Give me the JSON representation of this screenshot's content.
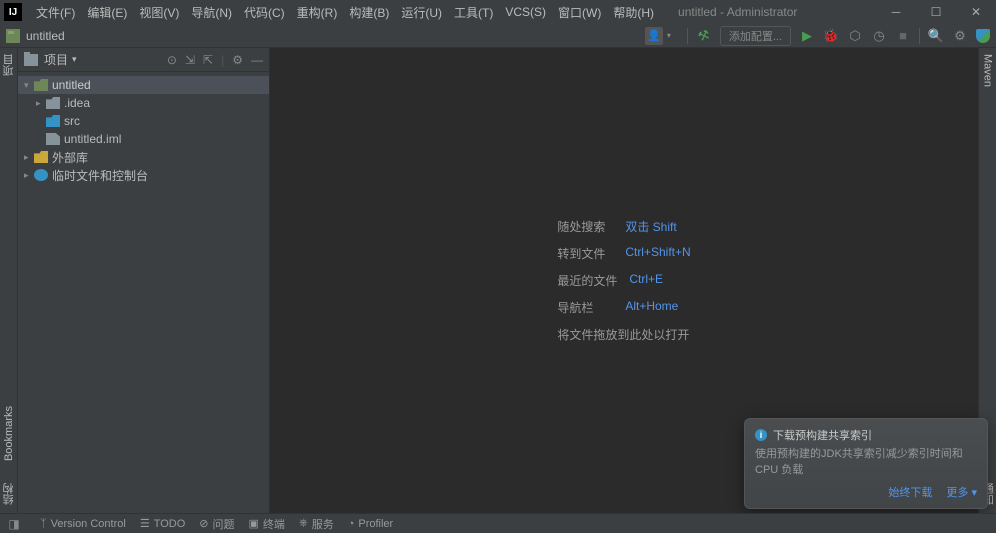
{
  "titlebar": {
    "logo": "IJ",
    "menu": [
      "文件(F)",
      "编辑(E)",
      "视图(V)",
      "导航(N)",
      "代码(C)",
      "重构(R)",
      "构建(B)",
      "运行(U)",
      "工具(T)",
      "VCS(S)",
      "窗口(W)",
      "帮助(H)"
    ],
    "title": "untitled - Administrator"
  },
  "navbar": {
    "project": "untitled",
    "run_config": "添加配置..."
  },
  "left_gutter": {
    "project": "项目",
    "bookmarks": "Bookmarks",
    "structure": "结构"
  },
  "right_gutter": {
    "maven": "Maven",
    "notifications": "通知"
  },
  "sidebar": {
    "title": "项目",
    "tree": {
      "root": "untitled",
      "root_path": "",
      "idea": ".idea",
      "src": "src",
      "iml": "untitled.iml",
      "external": "外部库",
      "scratches": "临时文件和控制台"
    }
  },
  "shortcuts": {
    "rows": [
      {
        "label": "随处搜索",
        "key": "双击 Shift"
      },
      {
        "label": "转到文件",
        "key": "Ctrl+Shift+N"
      },
      {
        "label": "最近的文件",
        "key": "Ctrl+E"
      },
      {
        "label": "导航栏",
        "key": "Alt+Home"
      }
    ],
    "drop": "将文件拖放到此处以打开"
  },
  "notification": {
    "title": "下载预构建共享索引",
    "body": "使用预构建的JDK共享索引减少索引时间和 CPU 负载",
    "action_download": "始终下载",
    "action_more": "更多"
  },
  "statusbar": {
    "vcs": "Version Control",
    "todo": "TODO",
    "problems": "问题",
    "terminal": "终端",
    "services": "服务",
    "profiler": "Profiler"
  }
}
